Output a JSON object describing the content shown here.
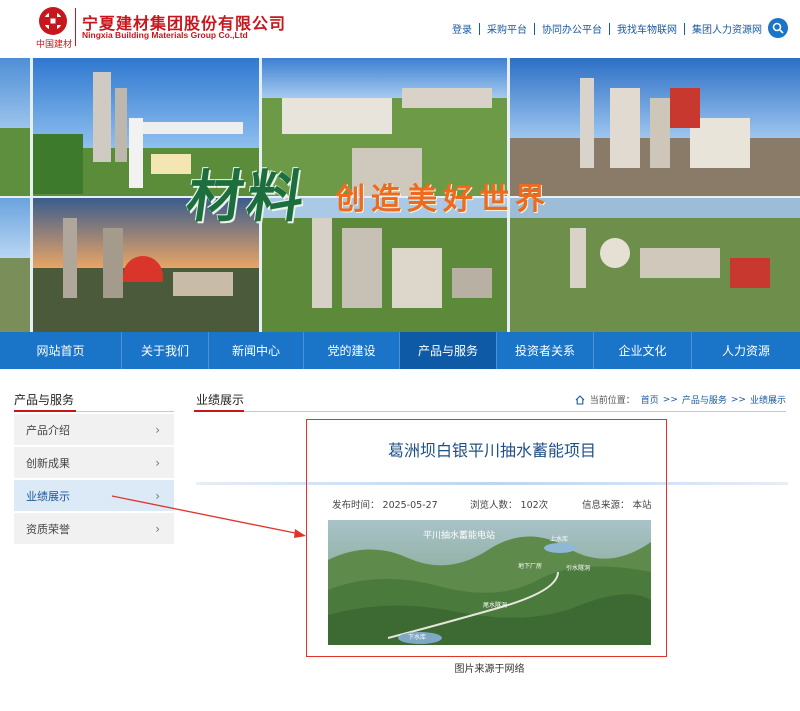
{
  "header": {
    "company_cn": "宁夏建材集团股份有限公司",
    "company_en": "Ningxia Building Materials Group Co.,Ltd",
    "logo_sub": "中国建材",
    "logo_icon": "cnbm-logo-icon",
    "top_links": [
      "登录",
      "采购平台",
      "协同办公平台",
      "我找车物联网",
      "集团人力资源网"
    ],
    "search_icon": "search-icon"
  },
  "banner": {
    "slogan_big": "材料",
    "slogan_small": "创造美好世界"
  },
  "nav": {
    "items": [
      "网站首页",
      "关于我们",
      "新闻中心",
      "党的建设",
      "产品与服务",
      "投资者关系",
      "企业文化",
      "人力资源"
    ],
    "active_index": 4
  },
  "sidebar": {
    "title": "产品与服务",
    "items": [
      "产品介绍",
      "创新成果",
      "业绩展示",
      "资质荣誉"
    ],
    "active_index": 2,
    "chevron": "›"
  },
  "main": {
    "section_title": "业绩展示",
    "breadcrumb": {
      "label": "当前位置：",
      "home_icon": "home-icon",
      "items": [
        "首页",
        "产品与服务",
        "业绩展示"
      ],
      "separator": ">>"
    },
    "article": {
      "title": "葛洲坝白银平川抽水蓄能项目",
      "publish_time": "发布时间：  2025-05-27",
      "views": "浏览人数：  102次",
      "source": "信息来源：  本站",
      "image_labels": {
        "title": "平川抽水蓄能电站",
        "upper": "上水库",
        "plant": "地下厂房",
        "tunnel": "引水隧洞",
        "tail": "尾水隧洞",
        "lower": "下水库"
      },
      "caption": "图片来源于网络"
    }
  },
  "colors": {
    "brand_red": "#c8161d",
    "nav_blue": "#1a74c8",
    "nav_active": "#0f5aa6",
    "link_blue": "#1a5aa0",
    "annotation_red": "#e0342b"
  }
}
